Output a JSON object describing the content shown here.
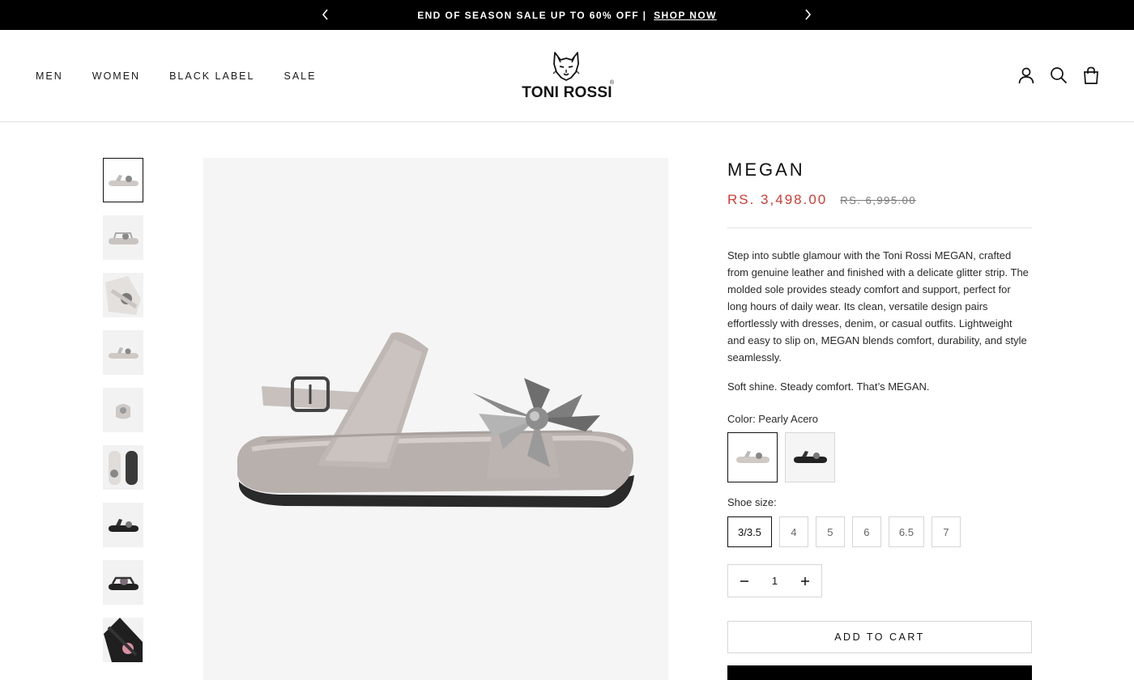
{
  "announcement": {
    "message": "END OF SEASON SALE UP TO 60% OFF |",
    "link": "SHOP NOW",
    "prev_icon": "chevron-left-icon",
    "next_icon": "chevron-right-icon"
  },
  "nav": {
    "items": [
      {
        "label": "MEN"
      },
      {
        "label": "WOMEN"
      },
      {
        "label": "BLACK LABEL"
      },
      {
        "label": "SALE"
      }
    ]
  },
  "brand": {
    "name": "TONI ROSSI",
    "registered": "®",
    "logo_icon": "wolf-head-icon"
  },
  "header_icons": [
    "account-icon",
    "search-icon",
    "cart-bag-icon"
  ],
  "gallery": {
    "thumbnail_count": 9,
    "active_index": 0
  },
  "product": {
    "title": "MEGAN",
    "sale_price": "RS. 3,498.00",
    "original_price": "RS. 6,995.00",
    "description": "Step into subtle glamour with the Toni Rossi MEGAN, crafted from genuine leather and finished with a delicate glitter strip. The molded sole provides steady comfort and support, perfect for long hours of daily wear. Its clean, versatile design pairs effortlessly with dresses, denim, or casual outfits. Lightweight and easy to slip on, MEGAN blends comfort, durability, and style seamlessly.",
    "tagline": "Soft shine. Steady comfort. That’s MEGAN.",
    "color_label": "Color: Pearly Acero",
    "colors": [
      "Pearly Acero",
      "Black"
    ],
    "size_label": "Shoe size:",
    "sizes": [
      {
        "label": "3/3.5",
        "selected": true
      },
      {
        "label": "4"
      },
      {
        "label": "5"
      },
      {
        "label": "6"
      },
      {
        "label": "6.5"
      },
      {
        "label": "7"
      }
    ],
    "quantity": "1",
    "add_to_cart": "ADD TO CART"
  },
  "colors": {
    "sale_red": "#d23a32",
    "black": "#000000",
    "border": "#d6d6d6"
  }
}
